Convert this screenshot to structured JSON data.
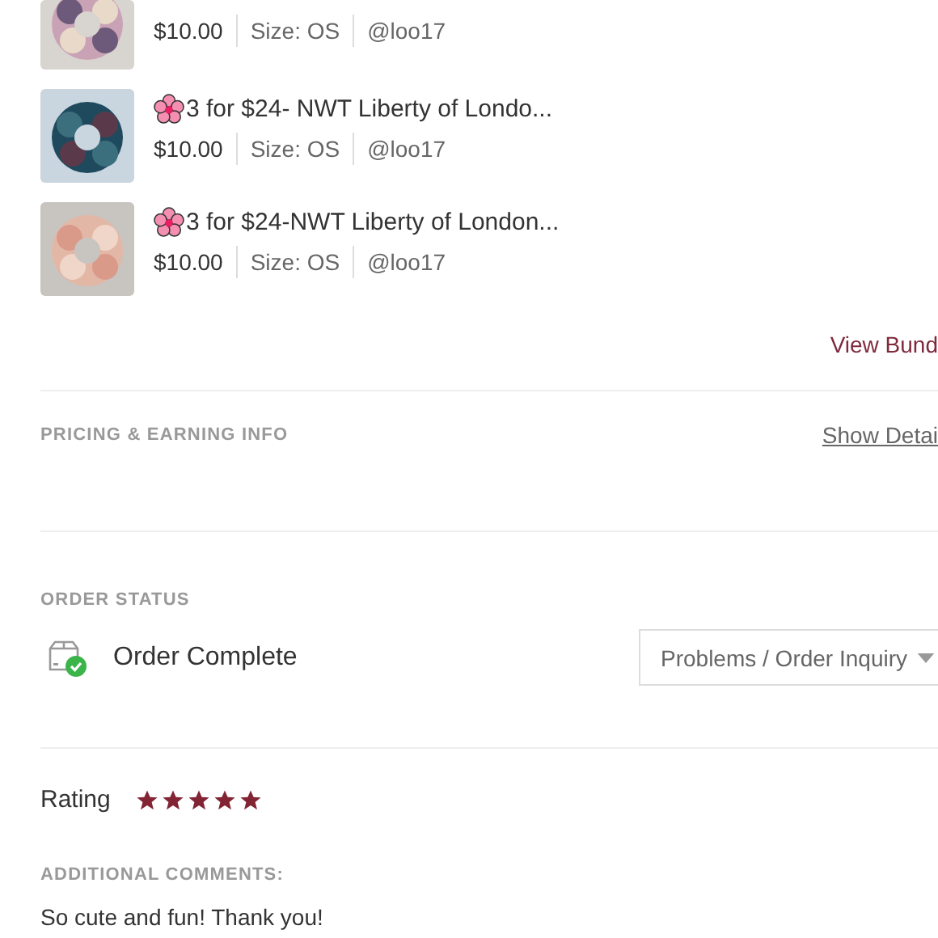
{
  "items": [
    {
      "price": "$10.00",
      "size": "Size: OS",
      "seller": "@loo17"
    },
    {
      "title": "3 for $24- NWT Liberty of Londo...",
      "price": "$10.00",
      "size": "Size: OS",
      "seller": "@loo17"
    },
    {
      "title": "3 for $24-NWT Liberty of London...",
      "price": "$10.00",
      "size": "Size: OS",
      "seller": "@loo17"
    }
  ],
  "view_bundle_link": "View Bund",
  "pricing": {
    "heading": "PRICING & EARNING INFO",
    "link": "Show Detai"
  },
  "order_status": {
    "heading": "ORDER STATUS",
    "status": "Order Complete",
    "dropdown": "Problems / Order Inquiry"
  },
  "rating": {
    "label": "Rating",
    "stars": 5
  },
  "comments": {
    "heading": "ADDITIONAL COMMENTS:",
    "text": "So cute and fun! Thank you!"
  }
}
